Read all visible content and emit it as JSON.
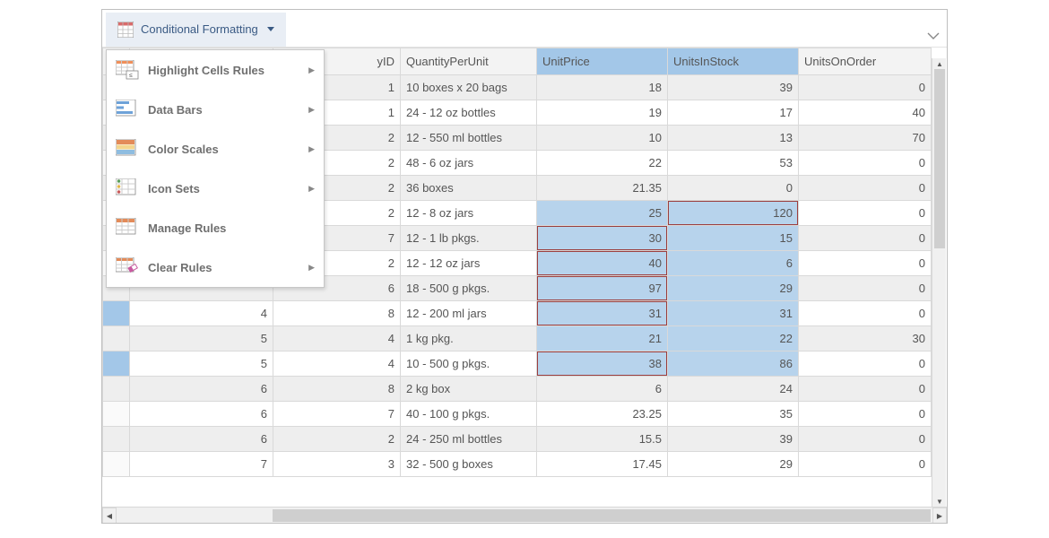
{
  "toolbar": {
    "cf_button_label": "Conditional Formatting"
  },
  "menu": {
    "items": [
      {
        "label": "Highlight Cells Rules",
        "has_submenu": true
      },
      {
        "label": "Data Bars",
        "has_submenu": true
      },
      {
        "label": "Color Scales",
        "has_submenu": true
      },
      {
        "label": "Icon Sets",
        "has_submenu": true
      },
      {
        "label": "Manage Rules",
        "has_submenu": false
      },
      {
        "label": "Clear Rules",
        "has_submenu": true
      }
    ]
  },
  "grid": {
    "columns": {
      "c0": "",
      "c1": "yID",
      "c2": "QuantityPerUnit",
      "c3": "UnitPrice",
      "c4": "UnitsInStock",
      "c5": "UnitsOnOrder"
    },
    "rows": [
      {
        "a": "",
        "b": "1",
        "c": "10 boxes x 20 bags",
        "d": "18",
        "e": "39",
        "f": "0",
        "blue_d": false,
        "blue_e": false,
        "red_d": false,
        "red_e": false,
        "ind_blue": false
      },
      {
        "a": "",
        "b": "1",
        "c": "24 - 12 oz bottles",
        "d": "19",
        "e": "17",
        "f": "40",
        "blue_d": false,
        "blue_e": false,
        "red_d": false,
        "red_e": false,
        "ind_blue": false
      },
      {
        "a": "",
        "b": "2",
        "c": "12 - 550 ml bottles",
        "d": "10",
        "e": "13",
        "f": "70",
        "blue_d": false,
        "blue_e": false,
        "red_d": false,
        "red_e": false,
        "ind_blue": false
      },
      {
        "a": "",
        "b": "2",
        "c": "48 - 6 oz jars",
        "d": "22",
        "e": "53",
        "f": "0",
        "blue_d": false,
        "blue_e": false,
        "red_d": false,
        "red_e": false,
        "ind_blue": false
      },
      {
        "a": "",
        "b": "2",
        "c": "36 boxes",
        "d": "21.35",
        "e": "0",
        "f": "0",
        "blue_d": false,
        "blue_e": false,
        "red_d": false,
        "red_e": false,
        "ind_blue": false
      },
      {
        "a": "",
        "b": "2",
        "c": "12 - 8 oz jars",
        "d": "25",
        "e": "120",
        "f": "0",
        "blue_d": true,
        "blue_e": true,
        "red_d": false,
        "red_e": true,
        "ind_blue": false
      },
      {
        "a": "",
        "b": "7",
        "c": "12 - 1 lb pkgs.",
        "d": "30",
        "e": "15",
        "f": "0",
        "blue_d": true,
        "blue_e": true,
        "red_d": true,
        "red_e": false,
        "ind_blue": false
      },
      {
        "a": "",
        "b": "2",
        "c": "12 - 12 oz jars",
        "d": "40",
        "e": "6",
        "f": "0",
        "blue_d": true,
        "blue_e": true,
        "red_d": true,
        "red_e": false,
        "ind_blue": false
      },
      {
        "a": "",
        "b": "6",
        "c": "18 - 500 g pkgs.",
        "d": "97",
        "e": "29",
        "f": "0",
        "blue_d": true,
        "blue_e": true,
        "red_d": true,
        "red_e": false,
        "ind_blue": false
      },
      {
        "a": "4",
        "b": "8",
        "c": "12 - 200 ml jars",
        "d": "31",
        "e": "31",
        "f": "0",
        "blue_d": true,
        "blue_e": true,
        "red_d": true,
        "red_e": false,
        "ind_blue": true
      },
      {
        "a": "5",
        "b": "4",
        "c": "1 kg pkg.",
        "d": "21",
        "e": "22",
        "f": "30",
        "blue_d": true,
        "blue_e": true,
        "red_d": false,
        "red_e": false,
        "ind_blue": true
      },
      {
        "a": "5",
        "b": "4",
        "c": "10 - 500 g pkgs.",
        "d": "38",
        "e": "86",
        "f": "0",
        "blue_d": true,
        "blue_e": true,
        "red_d": true,
        "red_e": false,
        "ind_blue": true
      },
      {
        "a": "6",
        "b": "8",
        "c": "2 kg box",
        "d": "6",
        "e": "24",
        "f": "0",
        "blue_d": false,
        "blue_e": false,
        "red_d": false,
        "red_e": false,
        "ind_blue": false
      },
      {
        "a": "6",
        "b": "7",
        "c": "40 - 100 g pkgs.",
        "d": "23.25",
        "e": "35",
        "f": "0",
        "blue_d": false,
        "blue_e": false,
        "red_d": false,
        "red_e": false,
        "ind_blue": false
      },
      {
        "a": "6",
        "b": "2",
        "c": "24 - 250 ml bottles",
        "d": "15.5",
        "e": "39",
        "f": "0",
        "blue_d": false,
        "blue_e": false,
        "red_d": false,
        "red_e": false,
        "ind_blue": false
      },
      {
        "a": "7",
        "b": "3",
        "c": "32 - 500 g boxes",
        "d": "17.45",
        "e": "29",
        "f": "0",
        "blue_d": false,
        "blue_e": false,
        "red_d": false,
        "red_e": false,
        "ind_blue": false
      }
    ]
  }
}
